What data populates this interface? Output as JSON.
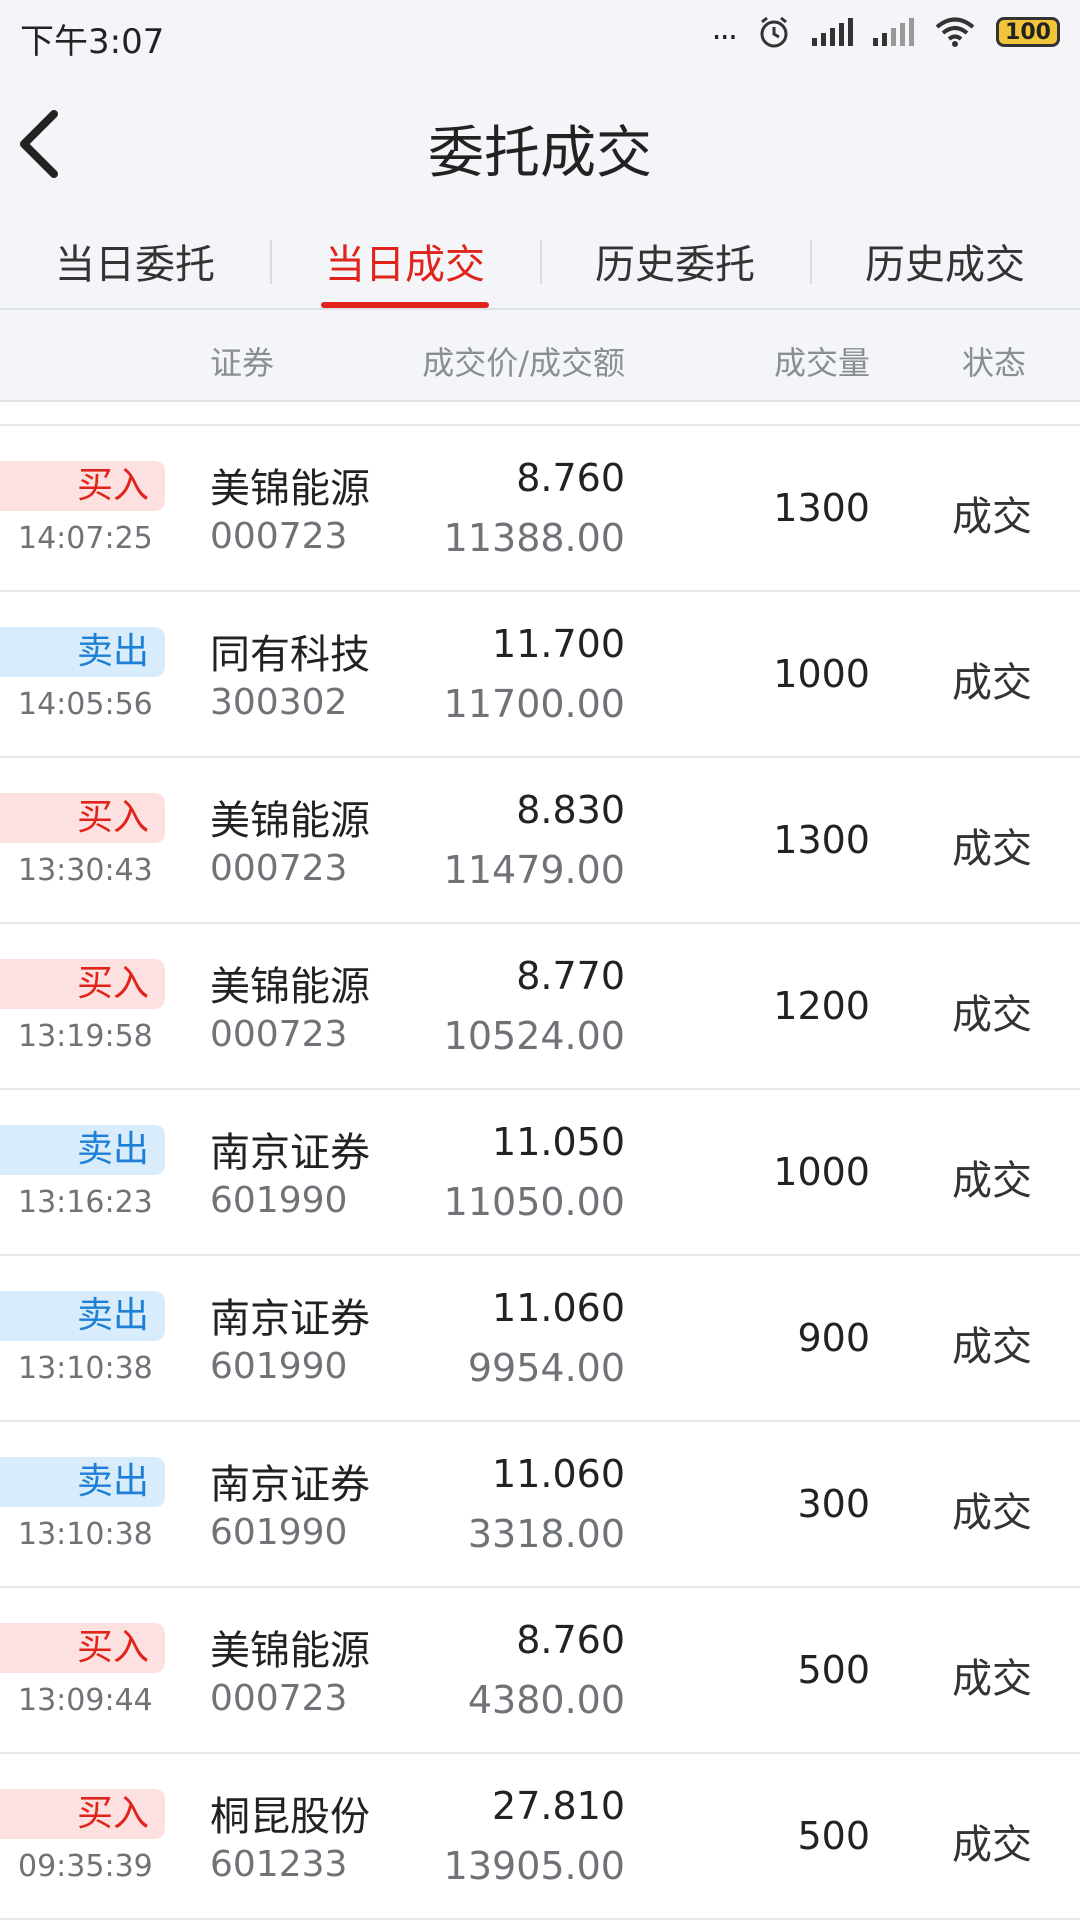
{
  "status_bar": {
    "time": "下午3:07",
    "dots": "...",
    "battery": "100"
  },
  "header": {
    "title": "委托成交"
  },
  "tabs": [
    {
      "label": "当日委托",
      "active": false
    },
    {
      "label": "当日成交",
      "active": true
    },
    {
      "label": "历史委托",
      "active": false
    },
    {
      "label": "历史成交",
      "active": false
    }
  ],
  "columns": {
    "security": "证券",
    "price_amount": "成交价/成交额",
    "volume": "成交量",
    "status": "状态"
  },
  "colors": {
    "accent_red": "#e0241b",
    "buy_bg": "#fde1e1",
    "sell_bg": "#d8ecfb",
    "sell_text": "#1d7fd6"
  },
  "rows": [
    {
      "side": "买入",
      "type": "buy",
      "time": "14:07:25",
      "name": "美锦能源",
      "code": "000723",
      "price": "8.760",
      "amount": "11388.00",
      "volume": "1300",
      "status": "成交"
    },
    {
      "side": "卖出",
      "type": "sell",
      "time": "14:05:56",
      "name": "同有科技",
      "code": "300302",
      "price": "11.700",
      "amount": "11700.00",
      "volume": "1000",
      "status": "成交"
    },
    {
      "side": "买入",
      "type": "buy",
      "time": "13:30:43",
      "name": "美锦能源",
      "code": "000723",
      "price": "8.830",
      "amount": "11479.00",
      "volume": "1300",
      "status": "成交"
    },
    {
      "side": "买入",
      "type": "buy",
      "time": "13:19:58",
      "name": "美锦能源",
      "code": "000723",
      "price": "8.770",
      "amount": "10524.00",
      "volume": "1200",
      "status": "成交"
    },
    {
      "side": "卖出",
      "type": "sell",
      "time": "13:16:23",
      "name": "南京证券",
      "code": "601990",
      "price": "11.050",
      "amount": "11050.00",
      "volume": "1000",
      "status": "成交"
    },
    {
      "side": "卖出",
      "type": "sell",
      "time": "13:10:38",
      "name": "南京证券",
      "code": "601990",
      "price": "11.060",
      "amount": "9954.00",
      "volume": "900",
      "status": "成交"
    },
    {
      "side": "卖出",
      "type": "sell",
      "time": "13:10:38",
      "name": "南京证券",
      "code": "601990",
      "price": "11.060",
      "amount": "3318.00",
      "volume": "300",
      "status": "成交"
    },
    {
      "side": "买入",
      "type": "buy",
      "time": "13:09:44",
      "name": "美锦能源",
      "code": "000723",
      "price": "8.760",
      "amount": "4380.00",
      "volume": "500",
      "status": "成交"
    },
    {
      "side": "买入",
      "type": "buy",
      "time": "09:35:39",
      "name": "桐昆股份",
      "code": "601233",
      "price": "27.810",
      "amount": "13905.00",
      "volume": "500",
      "status": "成交"
    }
  ]
}
